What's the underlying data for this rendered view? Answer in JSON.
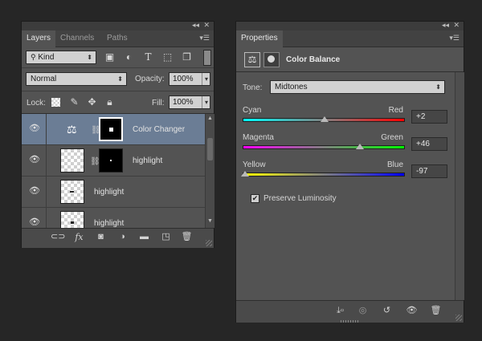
{
  "layers_panel": {
    "tabs": [
      {
        "label": "Layers",
        "active": true
      },
      {
        "label": "Channels",
        "active": false
      },
      {
        "label": "Paths",
        "active": false
      }
    ],
    "filter": {
      "value": "Kind"
    },
    "blend_mode": {
      "value": "Normal"
    },
    "opacity": {
      "label": "Opacity:",
      "value": "100%"
    },
    "lock": {
      "label": "Lock:"
    },
    "fill": {
      "label": "Fill:",
      "value": "100%"
    },
    "layers": [
      {
        "name": "Color Changer",
        "type": "adjustment",
        "selected": true
      },
      {
        "name": "highlight",
        "type": "masked",
        "selected": false
      },
      {
        "name": "highlight",
        "type": "pixel",
        "selected": false
      },
      {
        "name": "highlight",
        "type": "pixel",
        "selected": false
      }
    ],
    "footer_icons": [
      "link-icon",
      "fx-icon",
      "mask-icon",
      "adjustment-icon",
      "folder-icon",
      "new-layer-icon",
      "trash-icon"
    ]
  },
  "properties_panel": {
    "tab": "Properties",
    "header_title": "Color Balance",
    "tone": {
      "label": "Tone:",
      "value": "Midtones"
    },
    "sliders": [
      {
        "left": "Cyan",
        "right": "Red",
        "value": "+2",
        "level": 2
      },
      {
        "left": "Magenta",
        "right": "Green",
        "value": "+46",
        "level": 46
      },
      {
        "left": "Yellow",
        "right": "Blue",
        "value": "-97",
        "level": -97
      }
    ],
    "preserve_luminosity": {
      "label": "Preserve Luminosity",
      "checked": true
    },
    "footer_icons": [
      "clip-icon",
      "view-previous-icon",
      "reset-icon",
      "visibility-icon",
      "trash-icon"
    ]
  },
  "colors": {
    "panel_bg": "#535353",
    "selected_row": "#6b7d95"
  }
}
